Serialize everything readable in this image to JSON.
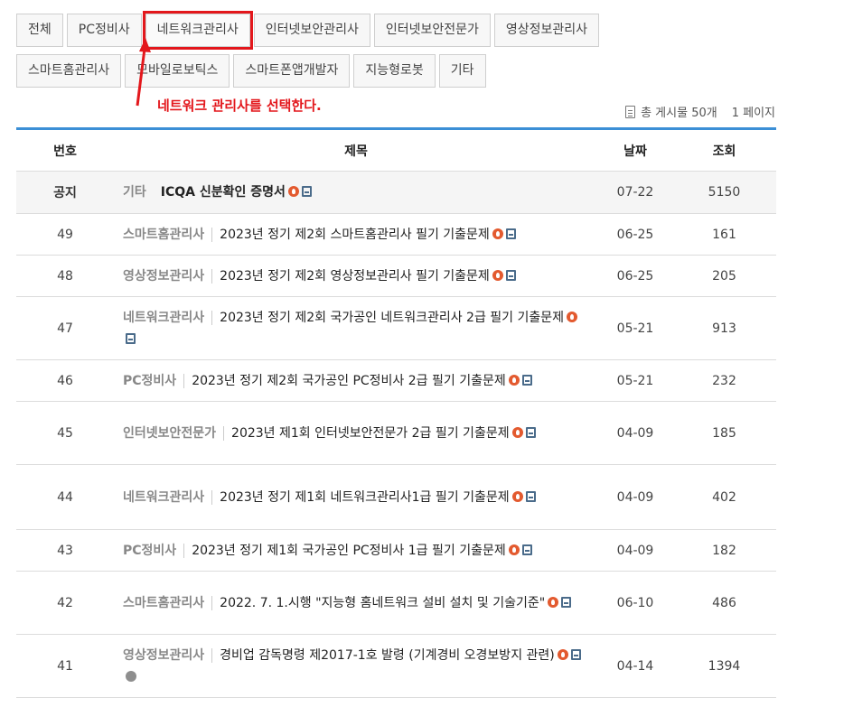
{
  "categories_row1": [
    "전체",
    "PC정비사",
    "네트워크관리사",
    "인터넷보안관리사",
    "인터넷보안전문가",
    "영상정보관리사"
  ],
  "categories_row2": [
    "스마트홈관리사",
    "모바일로보틱스",
    "스마트폰앱개발자",
    "지능형로봇",
    "기타"
  ],
  "selected_category": "네트워크관리사",
  "annotation": "네트워크 관리사를 선택한다.",
  "meta": {
    "total": "총 게시물 50개",
    "pages": "1 페이지"
  },
  "headers": {
    "num": "번호",
    "title": "제목",
    "date": "날짜",
    "views": "조회"
  },
  "posts": [
    {
      "num": "공지",
      "category": "기타",
      "title": "ICQA 신분확인 증명서",
      "date": "07-22",
      "views": "5150",
      "notice": true,
      "icons": [
        "fire-icon",
        "file-icon"
      ]
    },
    {
      "num": "49",
      "category": "스마트홈관리사",
      "title": "2023년 정기 제2회 스마트홈관리사 필기 기출문제",
      "date": "06-25",
      "views": "161",
      "icons": [
        "fire-icon",
        "file-icon"
      ]
    },
    {
      "num": "48",
      "category": "영상정보관리사",
      "title": "2023년 정기 제2회 영상정보관리사 필기 기출문제",
      "date": "06-25",
      "views": "205",
      "icons": [
        "fire-icon",
        "file-icon"
      ]
    },
    {
      "num": "47",
      "category": "네트워크관리사",
      "title": "2023년 정기 제2회 국가공인 네트워크관리사 2급 필기 기출문제",
      "date": "05-21",
      "views": "913",
      "icons": [
        "fire-icon",
        "file-icon"
      ]
    },
    {
      "num": "46",
      "category": "PC정비사",
      "title": "2023년 정기 제2회 국가공인 PC정비사 2급 필기 기출문제",
      "date": "05-21",
      "views": "232",
      "icons": [
        "fire-icon",
        "file-icon"
      ]
    },
    {
      "num": "45",
      "category": "인터넷보안전문가",
      "title": "2023년 제1회 인터넷보안전문가 2급 필기 기출문제",
      "date": "04-09",
      "views": "185",
      "icons": [
        "fire-icon",
        "file-icon"
      ]
    },
    {
      "num": "44",
      "category": "네트워크관리사",
      "title": "2023년 정기 제1회 네트워크관리사1급 필기 기출문제",
      "date": "04-09",
      "views": "402",
      "icons": [
        "fire-icon",
        "file-icon"
      ]
    },
    {
      "num": "43",
      "category": "PC정비사",
      "title": "2023년 정기 제1회 국가공인 PC정비사 1급 필기 기출문제",
      "date": "04-09",
      "views": "182",
      "icons": [
        "fire-icon",
        "file-icon"
      ]
    },
    {
      "num": "42",
      "category": "스마트홈관리사",
      "title": "2022. 7. 1.시행 \"지능형 홈네트워크 설비 설치 및 기술기준\"",
      "date": "06-10",
      "views": "486",
      "icons": [
        "fire-icon",
        "file-icon"
      ]
    },
    {
      "num": "41",
      "category": "영상정보관리사",
      "title": "경비업 감독명령 제2017-1호 발령 (기계경비 오경보방지 관련)",
      "date": "04-14",
      "views": "1394",
      "icons": [
        "fire-icon",
        "file-icon",
        "link-icon"
      ]
    }
  ]
}
